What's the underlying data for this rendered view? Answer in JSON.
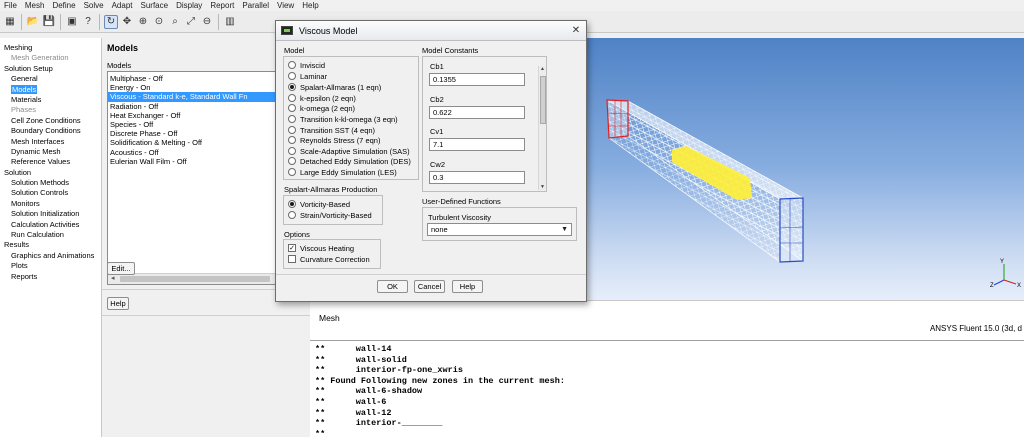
{
  "menubar": {
    "items": [
      "File",
      "Mesh",
      "Define",
      "Solve",
      "Adapt",
      "Surface",
      "Display",
      "Report",
      "Parallel",
      "View",
      "Help"
    ]
  },
  "nav": {
    "items": [
      {
        "label": "Meshing",
        "kind": "header"
      },
      {
        "label": "Mesh Generation",
        "kind": "dim"
      },
      {
        "label": "Solution Setup",
        "kind": "header"
      },
      {
        "label": "General",
        "kind": "item"
      },
      {
        "label": "Models",
        "kind": "selected"
      },
      {
        "label": "Materials",
        "kind": "item"
      },
      {
        "label": "Phases",
        "kind": "dim"
      },
      {
        "label": "Cell Zone Conditions",
        "kind": "item"
      },
      {
        "label": "Boundary Conditions",
        "kind": "item"
      },
      {
        "label": "Mesh Interfaces",
        "kind": "item"
      },
      {
        "label": "Dynamic Mesh",
        "kind": "item"
      },
      {
        "label": "Reference Values",
        "kind": "item"
      },
      {
        "label": "Solution",
        "kind": "header"
      },
      {
        "label": "Solution Methods",
        "kind": "item"
      },
      {
        "label": "Solution Controls",
        "kind": "item"
      },
      {
        "label": "Monitors",
        "kind": "item"
      },
      {
        "label": "Solution Initialization",
        "kind": "item"
      },
      {
        "label": "Calculation Activities",
        "kind": "item"
      },
      {
        "label": "Run Calculation",
        "kind": "item"
      },
      {
        "label": "Results",
        "kind": "header"
      },
      {
        "label": "Graphics and Animations",
        "kind": "item"
      },
      {
        "label": "Plots",
        "kind": "item"
      },
      {
        "label": "Reports",
        "kind": "item"
      }
    ]
  },
  "models_panel": {
    "title": "Models",
    "list_label": "Models",
    "items": [
      {
        "label": "Multiphase - Off",
        "selected": false
      },
      {
        "label": "Energy - On",
        "selected": false
      },
      {
        "label": "Viscous - Standard k-e, Standard Wall Fn",
        "selected": true
      },
      {
        "label": "Radiation - Off",
        "selected": false
      },
      {
        "label": "Heat Exchanger - Off",
        "selected": false
      },
      {
        "label": "Species - Off",
        "selected": false
      },
      {
        "label": "Discrete Phase - Off",
        "selected": false
      },
      {
        "label": "Solidification & Melting - Off",
        "selected": false
      },
      {
        "label": "Acoustics - Off",
        "selected": false
      },
      {
        "label": "Eulerian Wall Film - Off",
        "selected": false
      }
    ],
    "edit_label": "Edit...",
    "help_label": "Help"
  },
  "graphics": {
    "pane_label": "Mesh",
    "version": "ANSYS Fluent 15.0 (3d, d",
    "colors": {
      "wireframe": "#ffffff",
      "highlight": "#ffef3a",
      "edge": "#2b4cc4",
      "inlet": "#e02020"
    }
  },
  "console": {
    "lines": [
      "**      wall-14",
      "**      wall-solid",
      "**      interior-fp-one_xwris",
      "** Found Following new zones in the current mesh:",
      "**      wall-6-shadow",
      "**      wall-6",
      "**      wall-12",
      "**      interior-________",
      "**"
    ]
  },
  "dialog": {
    "title": "Viscous Model",
    "model_label": "Model",
    "model_options": [
      {
        "label": "Inviscid",
        "selected": false
      },
      {
        "label": "Laminar",
        "selected": false
      },
      {
        "label": "Spalart-Allmaras (1 eqn)",
        "selected": true
      },
      {
        "label": "k-epsilon (2 eqn)",
        "selected": false
      },
      {
        "label": "k-omega (2 eqn)",
        "selected": false
      },
      {
        "label": "Transition k-kl-omega (3 eqn)",
        "selected": false
      },
      {
        "label": "Transition SST (4 eqn)",
        "selected": false
      },
      {
        "label": "Reynolds Stress (7 eqn)",
        "selected": false
      },
      {
        "label": "Scale-Adaptive Simulation (SAS)",
        "selected": false
      },
      {
        "label": "Detached Eddy Simulation (DES)",
        "selected": false
      },
      {
        "label": "Large Eddy Simulation (LES)",
        "selected": false
      }
    ],
    "production_label": "Spalart-Allmaras Production",
    "production_options": [
      {
        "label": "Vorticity-Based",
        "selected": true
      },
      {
        "label": "Strain/Vorticity-Based",
        "selected": false
      }
    ],
    "options_label": "Options",
    "options": [
      {
        "label": "Viscous Heating",
        "checked": true
      },
      {
        "label": "Curvature Correction",
        "checked": false
      }
    ],
    "constants_label": "Model Constants",
    "constants": [
      {
        "label": "Cb1",
        "value": "0.1355"
      },
      {
        "label": "Cb2",
        "value": "0.622"
      },
      {
        "label": "Cv1",
        "value": "7.1"
      },
      {
        "label": "Cw2",
        "value": "0.3"
      }
    ],
    "udf_label": "User-Defined Functions",
    "turb_visc_label": "Turbulent Viscosity",
    "turb_visc_value": "none",
    "ok_label": "OK",
    "cancel_label": "Cancel",
    "help_label": "Help"
  }
}
